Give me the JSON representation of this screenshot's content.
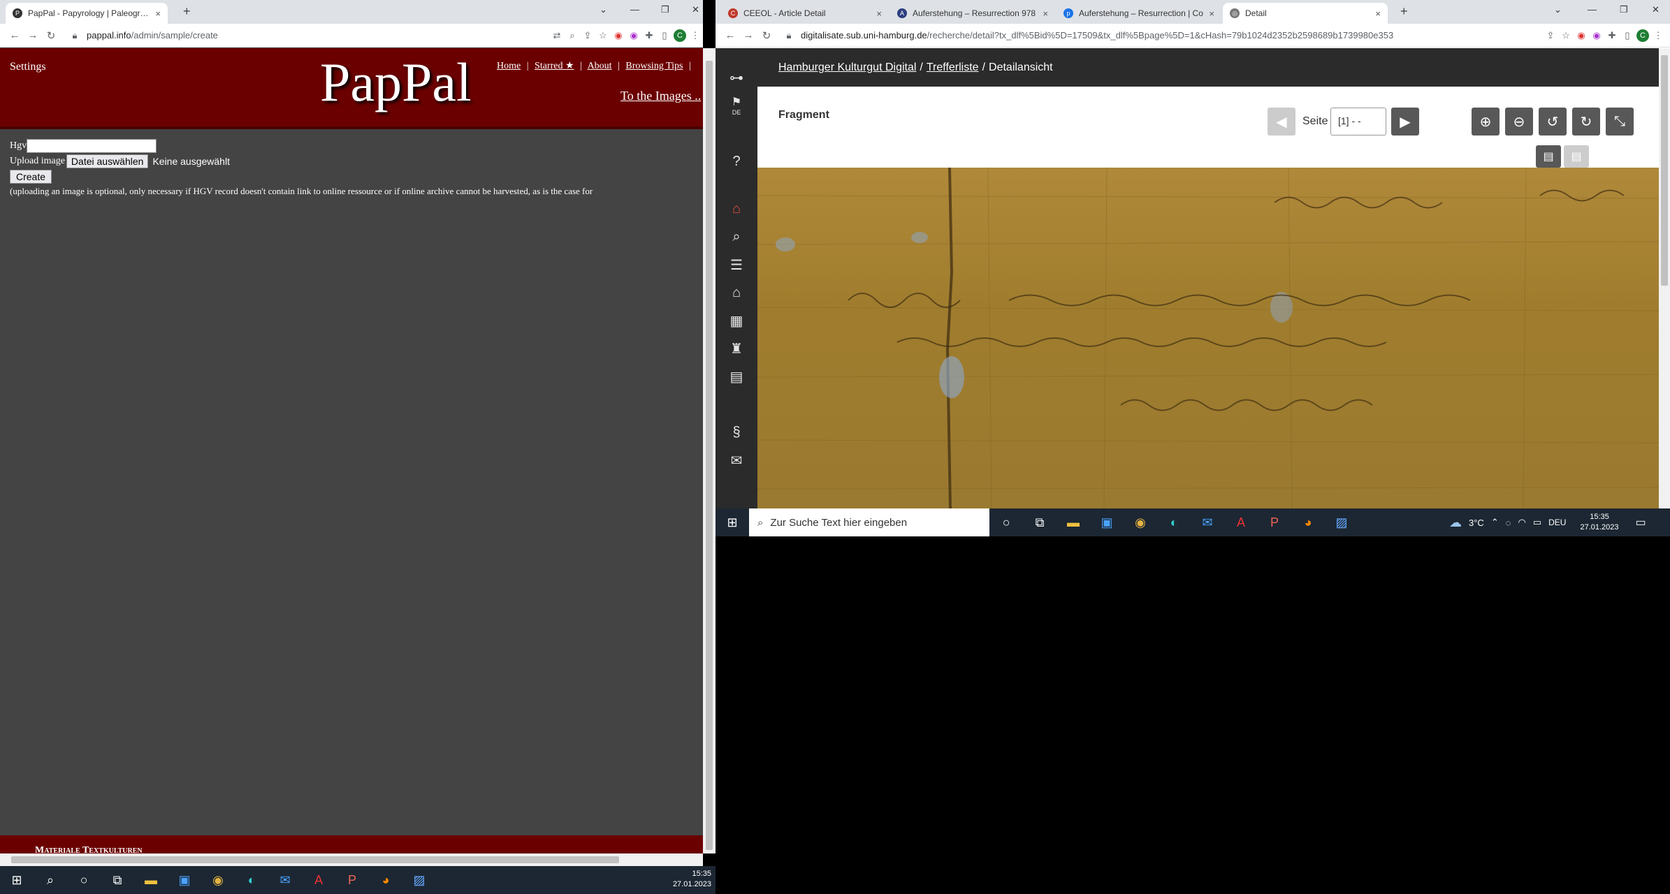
{
  "left": {
    "tabs": [
      {
        "label": "PapPal - Papyrology | Paleograph",
        "close": "×"
      }
    ],
    "newtab": "+",
    "win": {
      "chev": "⌄",
      "min": "—",
      "restore": "❐",
      "close": "✕"
    },
    "url": {
      "host": "pappal.info",
      "path": "/admin/sample/create"
    },
    "profile": "C",
    "site": {
      "settings": "Settings",
      "logo": "PapPal",
      "nav": [
        "Home",
        "Starred ★",
        "About",
        "Browsing Tips"
      ],
      "sep": "|",
      "to_images": "To the Images ..",
      "hgv_label": "Hgv",
      "hgv_value": "",
      "upload_label": "Upload image",
      "file_button": "Datei auswählen",
      "no_file": "Keine ausgewählt",
      "create": "Create",
      "note": "(uploading an image is optional, only necessary if HGV record doesn't contain link to online ressource or if online archive cannot be harvested, as is the case for",
      "footer": "Materiale Textkulturen"
    },
    "clock": {
      "time": "15:35",
      "date": "27.01.2023"
    }
  },
  "right": {
    "tabs": [
      {
        "label": "CEEOL - Article Detail",
        "close": "×",
        "color": "#c0392b"
      },
      {
        "label": "Auferstehung – Resurrection 978",
        "close": "×",
        "color": "#2c3e80"
      },
      {
        "label": "Auferstehung – Resurrection | Co",
        "close": "×",
        "color": "#1a73e8"
      },
      {
        "label": "Detail",
        "close": "×",
        "color": "#666"
      }
    ],
    "newtab": "+",
    "url": {
      "host": "digitalisate.sub.uni-hamburg.de",
      "path": "/recherche/detail?tx_dlf%5Bid%5D=17509&tx_dlf%5Bpage%5D=1&cHash=79b1024d2352b2598689b1739980e353"
    },
    "profile": "C",
    "breadcrumb": {
      "a": "Hamburger Kulturgut Digital",
      "b": "Trefferliste",
      "c": "Detailansicht",
      "sep": "/"
    },
    "sidebar": {
      "flag_label": "DE"
    },
    "fragment": "Fragment",
    "seite_label": "Seite",
    "seite_value": "[1] - -",
    "taskbar": {
      "search": "Zur Suche Text hier eingeben",
      "temp": "3°C",
      "lang": "DEU",
      "time": "15:35",
      "date": "27.01.2023"
    }
  }
}
